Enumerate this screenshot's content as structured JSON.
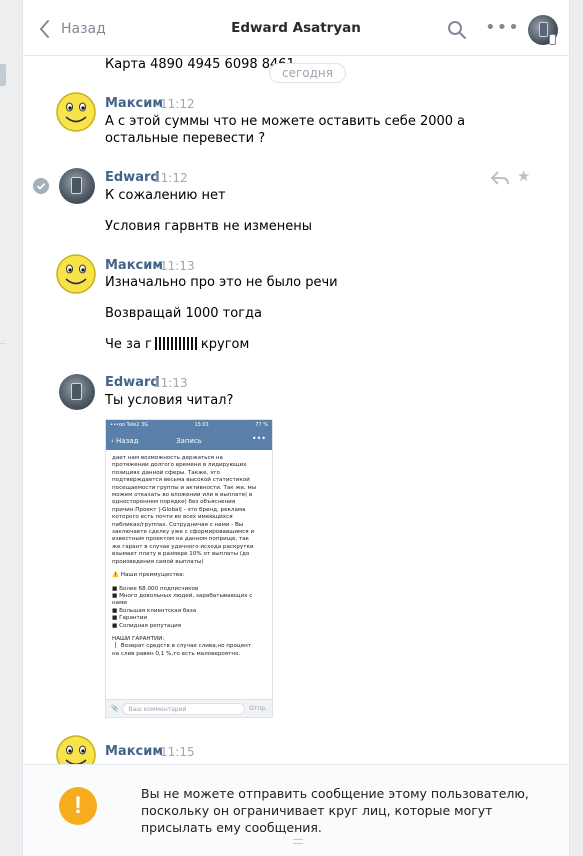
{
  "header": {
    "back_label": "Назад",
    "title": "Edward Asatryan"
  },
  "history": {
    "card_line": "Карта 4890 4945 6098 8461",
    "date_divider": "сегодня"
  },
  "messages": [
    {
      "author": "Максим",
      "time": "11:12",
      "lines": [
        "А с этой суммы что не можете оставить себе 2000 а",
        "остальные перевести ?"
      ]
    },
    {
      "author": "Edward",
      "time": "11:12",
      "lines": [
        "К сожалению нет",
        "Условия гарвнтв не изменены"
      ]
    },
    {
      "author": "Максим",
      "time": "11:13",
      "lines": [
        "Изначально про это не было речи",
        "Возвращай 1000 тогда"
      ],
      "censored_line": {
        "before": "Че за г",
        "after": "кругом"
      }
    },
    {
      "author": "Edward",
      "time": "11:13",
      "lines": [
        "Ты условия читал?"
      ]
    },
    {
      "author": "Максим",
      "time": "11:15",
      "lines": []
    }
  ],
  "screenshot_attachment": {
    "status_left": "•••oo Tele2  3G",
    "status_center": "15:01",
    "status_right": "77 %",
    "nav_back": "Назад",
    "nav_title": "Запись",
    "nav_more": "•••",
    "body_lines": [
      "дает нам возможность держаться на",
      "протяжении долгого времени в лидирующих",
      "позициях данной сферы. Также, это",
      "подтверждается весьма высокой статистикой",
      "посещаемости группы и активности. Так же, мы",
      "можем отказать во вложении или в выплате( в",
      "одностороннем порядке) без объяснения",
      "причин.Проект |-Global| - это бренд, реклама",
      "которого есть почти во всех имеющихся",
      "пабликах/группах. Сотрудничая с нами - Вы",
      "заключаете сделку уже с сформировавшимся и",
      "известным проектом на данном поприще, так",
      "же гарант в случае удачного исхода раскрутки",
      "взымает плату в размере 10% от выплаты (до",
      "произведения самой выплаты)"
    ],
    "advantages_title": "⚠️ Наши преимущества:",
    "advantages": [
      "■ Более 68.000 подписчиков",
      "■ Много довольных людей, зарабатывающих с",
      "нами",
      "■ Большая клиентская база",
      "■ Гарантии",
      "■ Солидная репутация"
    ],
    "guarantees_title": "НАШИ ГАРАНТИИ:",
    "guarantees": [
      "❗ Возврат средств в случае слива,но процент",
      "на слив равен 0,1 %,то есть маловероятно."
    ],
    "input_placeholder": "Ваш комментарий",
    "send_label": "Отпр."
  },
  "composer": {
    "notice": "Вы не можете отправить сообщение этому пользователю, поскольку он ограничивает круг лиц, которые могут присылать ему сообщения."
  },
  "colors": {
    "author": "#42648b",
    "warning": "#f7ac1d",
    "accent": "#5a7fa8"
  }
}
